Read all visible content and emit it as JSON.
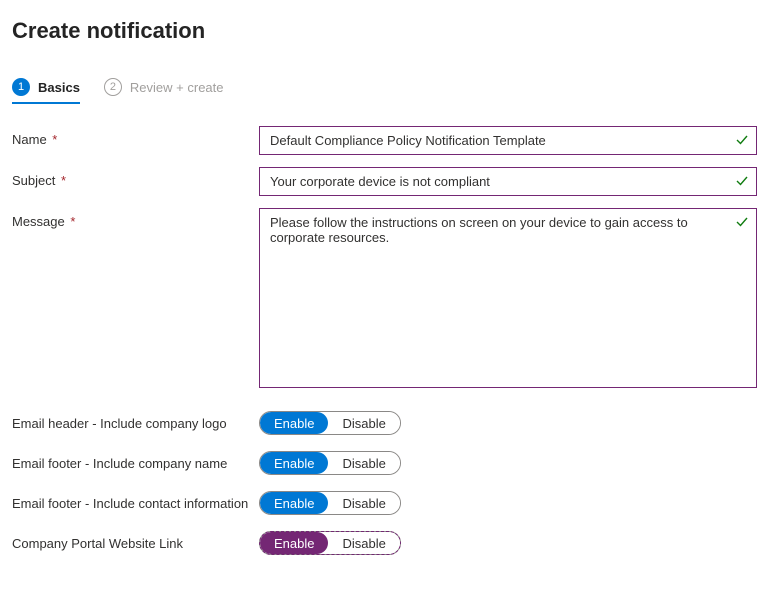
{
  "page_title": "Create notification",
  "tabs": {
    "basics_num": "1",
    "basics_label": "Basics",
    "review_num": "2",
    "review_label": "Review + create"
  },
  "fields": {
    "name_label": "Name",
    "name_value": "Default Compliance Policy Notification Template",
    "subject_label": "Subject",
    "subject_value": "Your corporate device is not compliant",
    "message_label": "Message",
    "message_value": "Please follow the instructions on screen on your device to gain access to corporate resources."
  },
  "toggles": {
    "header_logo_label": "Email header - Include company logo",
    "footer_name_label": "Email footer - Include company name",
    "footer_contact_label": "Email footer - Include contact information",
    "portal_link_label": "Company Portal Website Link",
    "enable": "Enable",
    "disable": "Disable"
  }
}
